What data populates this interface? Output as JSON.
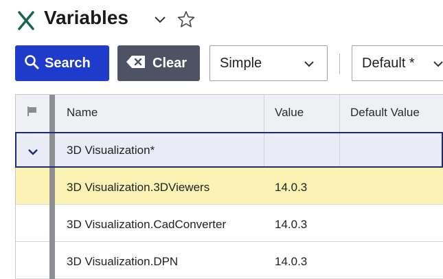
{
  "header": {
    "title": "Variables",
    "icons": {
      "app": "variables-x-icon",
      "dropdown": "chevron-down-icon",
      "favorite": "star-outline-icon"
    }
  },
  "toolbar": {
    "search_label": "Search",
    "clear_label": "Clear",
    "mode_value": "Simple",
    "view_value": "Default *"
  },
  "table": {
    "columns": [
      "Name",
      "Value",
      "Default Value"
    ],
    "group": {
      "name": "3D Visualization*",
      "expanded": true
    },
    "rows": [
      {
        "name": "3D Visualization.3DViewers",
        "value": "14.0.3",
        "default": "",
        "highlighted": true
      },
      {
        "name": "3D Visualization.CadConverter",
        "value": "14.0.3",
        "default": "",
        "highlighted": false
      },
      {
        "name": "3D Visualization.DPN",
        "value": "14.0.3",
        "default": "",
        "highlighted": false
      }
    ]
  },
  "colors": {
    "primary": "#1f3bcc",
    "secondary": "#4d5365",
    "highlight_row": "#fbf2b4",
    "group_row": "#e9ecf7",
    "group_border": "#1e2a7a",
    "brand_green": "#15654f"
  }
}
